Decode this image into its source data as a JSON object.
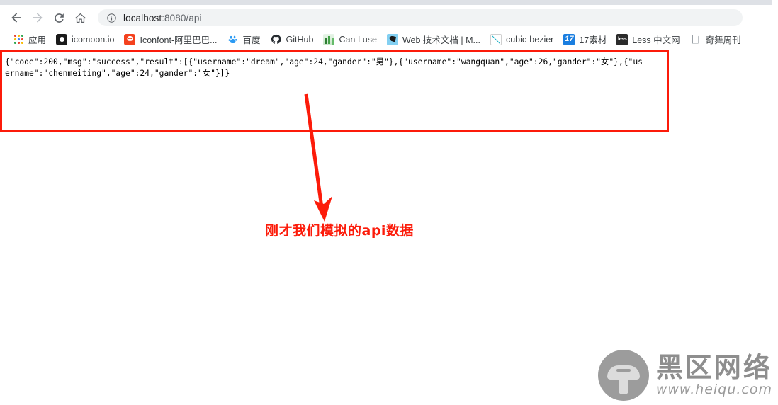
{
  "browser": {
    "nav": {
      "back_icon": "arrow-left-icon",
      "forward_icon": "arrow-right-icon",
      "reload_icon": "reload-icon",
      "home_icon": "home-icon"
    },
    "omnibox": {
      "info_icon": "info-circle-icon",
      "host": "localhost",
      "path": ":8080/api",
      "full_url": "localhost:8080/api"
    },
    "bookmarks": [
      {
        "label": "应用",
        "icon": "apps-grid-icon"
      },
      {
        "label": "icomoon.io",
        "icon": "icomoon-icon"
      },
      {
        "label": "Iconfont-阿里巴巴...",
        "icon": "iconfont-alien-icon"
      },
      {
        "label": "百度",
        "icon": "baidu-paw-icon"
      },
      {
        "label": "GitHub",
        "icon": "github-icon"
      },
      {
        "label": "Can I use",
        "icon": "caniuse-chart-icon"
      },
      {
        "label": "Web 技术文档 | M...",
        "icon": "mdn-dino-icon"
      },
      {
        "label": "cubic-bezier",
        "icon": "cubic-bezier-curve-icon"
      },
      {
        "label": "17素材",
        "icon": "17sucai-icon"
      },
      {
        "label": "Less 中文网",
        "icon": "less-icon"
      },
      {
        "label": "奇舞周刊",
        "icon": "document-page-icon"
      }
    ]
  },
  "page": {
    "response_text": "{\"code\":200,\"msg\":\"success\",\"result\":[{\"username\":\"dream\",\"age\":24,\"gander\":\"男\"},{\"username\":\"wangquan\",\"age\":26,\"gander\":\"女\"},{\"username\":\"chenmeiting\",\"age\":24,\"gander\":\"女\"}]}",
    "response_json": {
      "code": 200,
      "msg": "success",
      "result": [
        {
          "username": "dream",
          "age": 24,
          "gander": "男"
        },
        {
          "username": "wangquan",
          "age": 26,
          "gander": "女"
        },
        {
          "username": "chenmeiting",
          "age": 24,
          "gander": "女"
        }
      ]
    }
  },
  "annotation": {
    "text": "刚才我们模拟的api数据",
    "color": "#fc1b0a",
    "highlight_box_label": "json-response-highlight-box",
    "arrow_label": "annotation-arrow"
  },
  "watermark": {
    "brand_cn": "黑区网络",
    "url": "www.heiqu.com",
    "color": "#8e8e8e"
  }
}
